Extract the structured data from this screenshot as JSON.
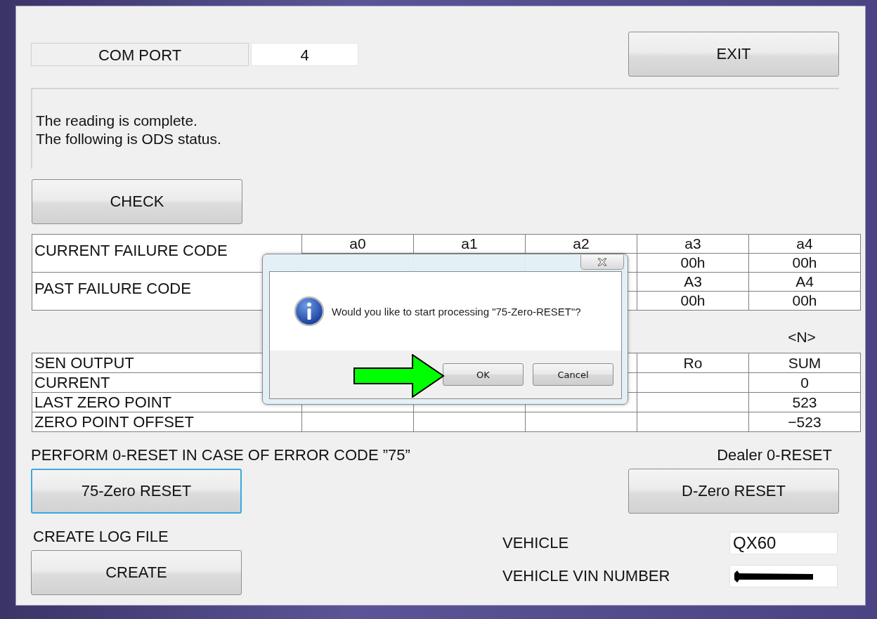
{
  "com_port": {
    "label": "COM PORT",
    "value": "4"
  },
  "exit_button": "EXIT",
  "message": [
    "The reading is complete.",
    "The following is ODS status."
  ],
  "check_button": "CHECK",
  "failure_table": [
    {
      "label": "CURRENT FAILURE CODE",
      "headers": {
        "column_1": "a0",
        "column_2": "a1",
        "column_3": "a2",
        "column_4": "a3",
        "column_5": "a4"
      },
      "values": {
        "column_4": "00h",
        "column_5": "00h"
      }
    },
    {
      "label": "PAST FAILURE CODE",
      "headers": {
        "column_4": "A3",
        "column_5": "A4"
      },
      "values": {
        "column_4": "00h",
        "column_5": "00h"
      }
    }
  ],
  "unit_label": "<N>",
  "sensor_table": [
    {
      "label": "SEN OUTPUT",
      "cells": {
        "column_4": "Ro",
        "column_5": "SUM"
      }
    },
    {
      "label": "CURRENT",
      "cells": {
        "column_5": "0"
      }
    },
    {
      "label": "LAST ZERO POINT",
      "cells": {
        "column_5": "523"
      }
    },
    {
      "label": "ZERO POINT OFFSET",
      "cells": {
        "column_5": "−523"
      }
    }
  ],
  "zero_reset": {
    "caption": "PERFORM 0-RESET IN CASE OF ERROR CODE ”75”",
    "button": "75-Zero RESET",
    "focused": true
  },
  "dealer_reset": {
    "caption": "Dealer 0-RESET",
    "button": "D-Zero RESET",
    "focused": false
  },
  "log_file": {
    "caption": "CREATE LOG FILE",
    "button": "CREATE"
  },
  "vehicle_fields": [
    {
      "label": "VEHICLE",
      "value": "QX60",
      "redacted": false
    },
    {
      "label": "VEHICLE VIN NUMBER",
      "redacted": true
    }
  ],
  "dialog": {
    "message": "Would you like to start processing \"75-Zero-RESET\"?",
    "buttons": [
      {
        "label": "OK",
        "pointed": true
      },
      {
        "label": "Cancel",
        "pointed": false
      }
    ]
  }
}
